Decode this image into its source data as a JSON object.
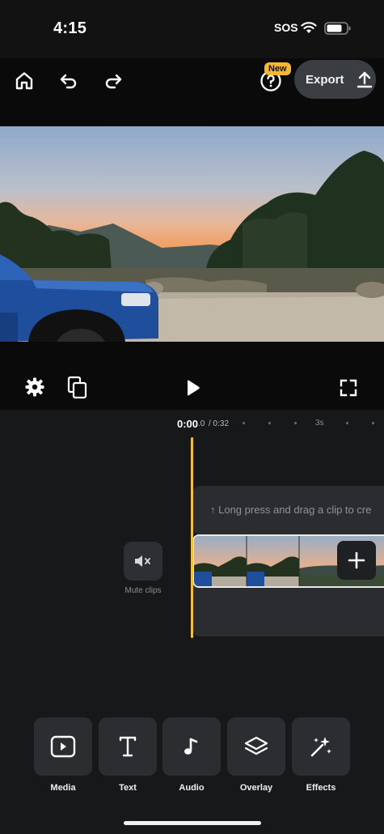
{
  "status_bar": {
    "time": "4:15",
    "carrier": "SOS"
  },
  "toolbar": {
    "new_badge": "New",
    "export_label": "Export"
  },
  "timeline": {
    "current_time": "0:00",
    "current_time_fraction": ".0",
    "total_time": "/ 0:32",
    "tick_label": "3s",
    "hint": "↑ Long press and drag a clip to cre"
  },
  "mute": {
    "label": "Mute clips"
  },
  "tools": [
    {
      "label": "Media",
      "icon": "media-icon"
    },
    {
      "label": "Text",
      "icon": "text-icon"
    },
    {
      "label": "Audio",
      "icon": "audio-icon"
    },
    {
      "label": "Overlay",
      "icon": "overlay-icon"
    },
    {
      "label": "Effects",
      "icon": "effects-icon"
    }
  ],
  "colors": {
    "accent_playhead": "#f5c22b",
    "badge": "#f5b82e",
    "truck": "#1f4f9c"
  }
}
